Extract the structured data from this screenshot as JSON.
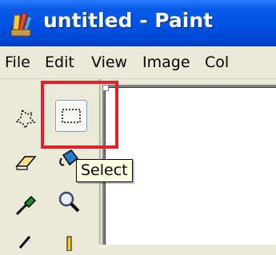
{
  "window": {
    "title": "untitled - Paint",
    "app_icon": "paint-app-icon"
  },
  "menu": {
    "items": [
      "File",
      "Edit",
      "View",
      "Image",
      "Col"
    ]
  },
  "toolbox": {
    "tools": [
      {
        "name": "free-form-select",
        "icon": "free-form-select-icon"
      },
      {
        "name": "select",
        "icon": "rectangle-select-icon",
        "pressed": true
      },
      {
        "name": "eraser",
        "icon": "eraser-icon"
      },
      {
        "name": "fill-with-color",
        "icon": "paint-bucket-icon"
      },
      {
        "name": "pick-color",
        "icon": "eyedropper-icon"
      },
      {
        "name": "magnifier",
        "icon": "magnifier-icon"
      },
      {
        "name": "pencil",
        "icon": "pencil-icon"
      },
      {
        "name": "brush",
        "icon": "brush-icon"
      }
    ]
  },
  "tooltip": {
    "text": "Select"
  },
  "colors": {
    "titlebar": "#0054e3",
    "highlight": "#e6202a",
    "tooltip_bg": "#ffffe1"
  }
}
